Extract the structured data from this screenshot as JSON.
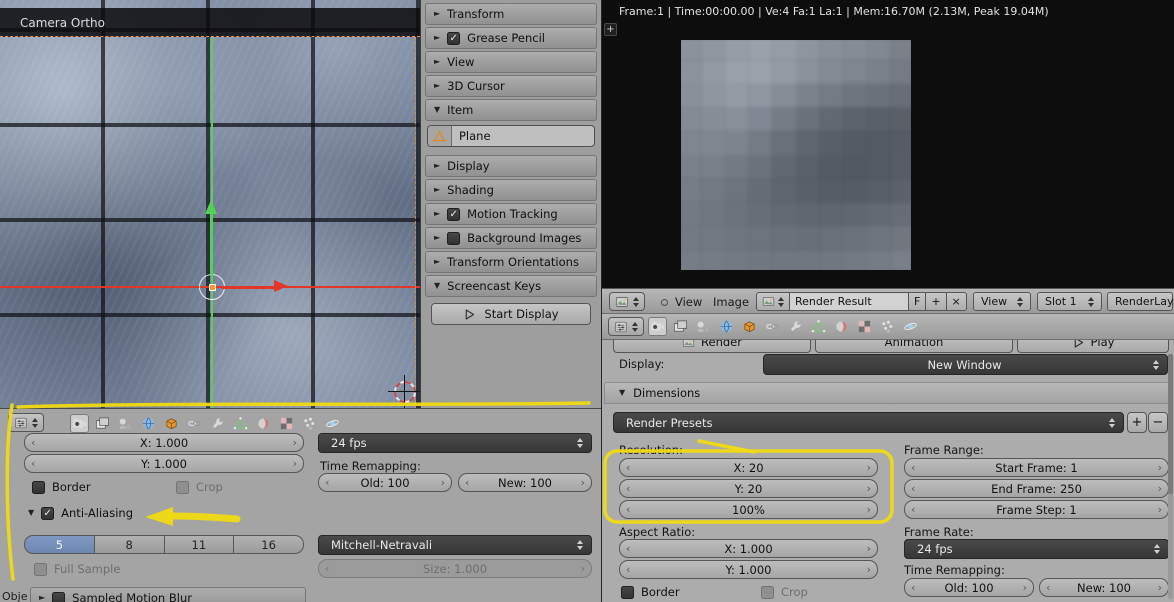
{
  "colors": {
    "annotation_yellow": "#f0da12",
    "selected_blue": "#6c87b0",
    "axis_green": "#53d353",
    "axis_red": "#e23629",
    "camera_frame_orange": "#e8953c"
  },
  "viewport": {
    "camera_label": "Camera Ortho"
  },
  "npanel": {
    "panels": [
      {
        "label": "Transform"
      },
      {
        "label": "Grease Pencil"
      },
      {
        "label": "View"
      },
      {
        "label": "3D Cursor"
      },
      {
        "label": "Item"
      },
      {
        "label": "Display"
      },
      {
        "label": "Shading"
      },
      {
        "label": "Motion Tracking"
      },
      {
        "label": "Background Images"
      },
      {
        "label": "Transform Orientations"
      },
      {
        "label": "Screencast Keys"
      }
    ],
    "item_name": "Plane",
    "start_display": "Start Display"
  },
  "bottom_props": {
    "tabs": {
      "tabs": [
        "render",
        "render-layers",
        "scene",
        "world",
        "object",
        "constraints",
        "modifiers",
        "object-data",
        "material",
        "texture",
        "particles",
        "physics"
      ],
      "active": "render"
    },
    "res_x": "X: 1.000",
    "res_y": "Y: 1.000",
    "border": "Border",
    "crop": "Crop",
    "fps": "24 fps",
    "time_remapping": "Time Remapping:",
    "old": "Old: 100",
    "new": "New: 100",
    "anti_aliasing": "Anti-Aliasing",
    "samples": [
      "5",
      "8",
      "11",
      "16"
    ],
    "active_sample": "5",
    "filter": "Mitchell-Netravali",
    "full_sample": "Full Sample",
    "size": "Size: 1.000",
    "sampled_motion_blur": "Sampled Motion Blur",
    "corner_label": "Obje"
  },
  "image_editor": {
    "stats": "Frame:1 | Time:00:00.00 | Ve:4 Fa:1 La:1 | Mem:16.70M (2.13M, Peak 19.04M)",
    "expand_button": "+",
    "menu_view": "View",
    "menu_image": "Image",
    "datablock": "Render Result",
    "fake_user": "F",
    "new_button": "+",
    "unlink_button": "×",
    "view_mode": "View",
    "slot": "Slot 1",
    "render_layer": "RenderLayer",
    "render_pixels": [
      [
        "#8b929b",
        "#9097a0",
        "#959da6",
        "#99a1aa",
        "#959ca5",
        "#8e959e",
        "#888f98",
        "#858c95",
        "#81888f",
        "#7a8189"
      ],
      [
        "#8d939c",
        "#939aa3",
        "#99a1aa",
        "#9aa2ab",
        "#949ba4",
        "#8b929b",
        "#848b94",
        "#7f868f",
        "#7a8189",
        "#747b84"
      ],
      [
        "#8a9099",
        "#9096a0",
        "#949ba4",
        "#9097a0",
        "#868d97",
        "#7b828c",
        "#747b84",
        "#6e757e",
        "#6a717a",
        "#676e77"
      ],
      [
        "#858b94",
        "#888e98",
        "#8a9099",
        "#828893",
        "#757c86",
        "#6a717b",
        "#626973",
        "#5c636d",
        "#596069",
        "#586068"
      ],
      [
        "#80868f",
        "#81878f",
        "#7e848e",
        "#747b85",
        "#69707a",
        "#5f6670",
        "#585f68",
        "#545b64",
        "#535a63",
        "#555c65"
      ],
      [
        "#7b818a",
        "#7a808a",
        "#747a84",
        "#6b727b",
        "#61686f",
        "#5a6169",
        "#545b64",
        "#525962",
        "#535a63",
        "#565d66"
      ],
      [
        "#777d86",
        "#747a83",
        "#6e747e",
        "#666d76",
        "#5e656e",
        "#596067",
        "#565d66",
        "#555c65",
        "#575e67",
        "#5b626b"
      ],
      [
        "#747a83",
        "#72787f",
        "#6c737c",
        "#676e77",
        "#636a71",
        "#60676e",
        "#5f666f",
        "#60676f",
        "#636a73",
        "#666d76"
      ],
      [
        "#747a83",
        "#737980",
        "#70767f",
        "#6d747d",
        "#6a717a",
        "#686f78",
        "#697079",
        "#6b727b",
        "#6e757e",
        "#71777f"
      ],
      [
        "#777d86",
        "#767c85",
        "#747a83",
        "#72787f",
        "#71777f",
        "#70777f",
        "#71787f",
        "#747a83",
        "#767c85",
        "#797f88"
      ]
    ]
  },
  "right_props": {
    "tabs": {
      "tabs": [
        "render",
        "render-layers",
        "scene",
        "world",
        "object",
        "constraints",
        "modifiers",
        "object-data",
        "material",
        "texture",
        "particles",
        "physics"
      ],
      "active": "render"
    },
    "render_button": "Render",
    "animation_button": "Animation",
    "play_button": "Play",
    "display_label": "Display:",
    "display_value": "New Window",
    "dimensions": "Dimensions",
    "render_presets": "Render Presets",
    "add_preset": "+",
    "remove_preset": "−",
    "resolution_label": "Resolution:",
    "res_x": "X: 20",
    "res_y": "Y: 20",
    "res_percent": "100%",
    "frame_range_label": "Frame Range:",
    "start_frame": "Start Frame: 1",
    "end_frame": "End Frame: 250",
    "frame_step": "Frame Step: 1",
    "aspect_label": "Aspect Ratio:",
    "aspect_x": "X: 1.000",
    "aspect_y": "Y: 1.000",
    "frame_rate_label": "Frame Rate:",
    "fps": "24 fps",
    "time_remapping": "Time Remapping:",
    "old": "Old: 100",
    "new": "New: 100",
    "border": "Border",
    "crop": "Crop"
  }
}
